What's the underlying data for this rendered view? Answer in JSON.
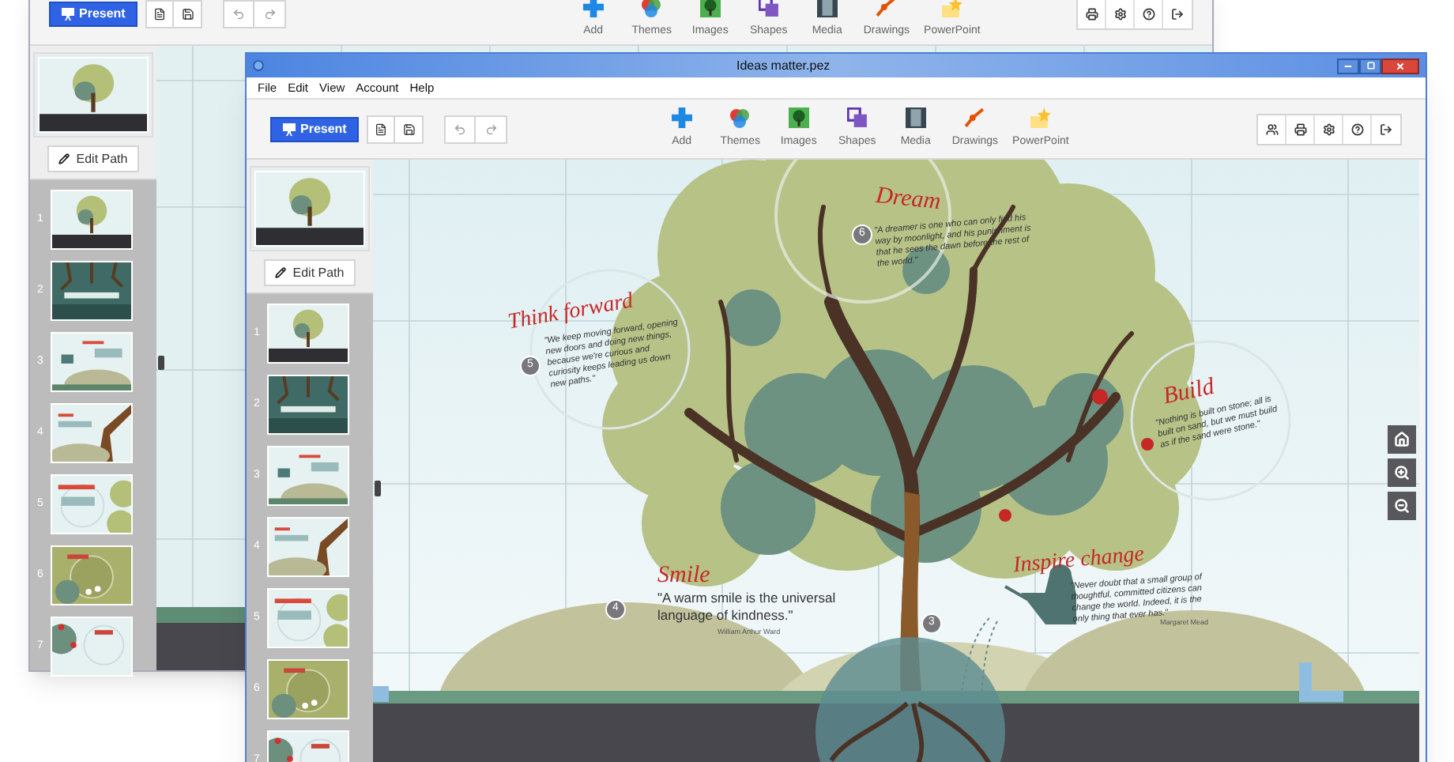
{
  "back_window": {
    "toolbar": {
      "present": "Present",
      "tools": [
        {
          "kind": "add",
          "label": "Add"
        },
        {
          "kind": "themes",
          "label": "Themes"
        },
        {
          "kind": "images",
          "label": "Images"
        },
        {
          "kind": "shapes",
          "label": "Shapes"
        },
        {
          "kind": "media",
          "label": "Media"
        },
        {
          "kind": "drawings",
          "label": "Drawings"
        },
        {
          "kind": "powerpoint",
          "label": "PowerPoint"
        }
      ]
    },
    "edit_path": "Edit Path",
    "slides": [
      {
        "number": "1"
      },
      {
        "number": "2"
      },
      {
        "number": "3"
      },
      {
        "number": "4"
      },
      {
        "number": "5"
      },
      {
        "number": "6"
      },
      {
        "number": "7"
      }
    ]
  },
  "front_window": {
    "title": "Ideas matter.pez",
    "menu": [
      "File",
      "Edit",
      "View",
      "Account",
      "Help"
    ],
    "toolbar": {
      "present": "Present",
      "tools": [
        {
          "kind": "add",
          "label": "Add"
        },
        {
          "kind": "themes",
          "label": "Themes"
        },
        {
          "kind": "images",
          "label": "Images"
        },
        {
          "kind": "shapes",
          "label": "Shapes"
        },
        {
          "kind": "media",
          "label": "Media"
        },
        {
          "kind": "drawings",
          "label": "Drawings"
        },
        {
          "kind": "powerpoint",
          "label": "PowerPoint"
        }
      ]
    },
    "edit_path": "Edit Path",
    "slides": [
      {
        "number": "1"
      },
      {
        "number": "2"
      },
      {
        "number": "3"
      },
      {
        "number": "4"
      },
      {
        "number": "5"
      },
      {
        "number": "6"
      },
      {
        "number": "7"
      }
    ],
    "canvas": {
      "topics": [
        {
          "number": "6",
          "title": "Dream",
          "quote": "\"A dreamer is one who can only find his way by moonlight, and his punishment is that he sees the dawn before the rest of the world.\""
        },
        {
          "number": "5",
          "title": "Think forward",
          "quote": "\"We keep moving forward, opening new doors and doing new things, because we're curious and curiosity keeps leading us down new paths.\""
        },
        {
          "title": "Build",
          "quote": "\"Nothing is built on stone; all is built on sand, but we must build as if the sand were stone.\""
        },
        {
          "number": "4",
          "title": "Smile",
          "quote": "\"A warm smile is the universal language of kindness.\"",
          "author": "William Arthur Ward"
        },
        {
          "number": "3",
          "title": "Inspire change",
          "quote": "\"Never doubt that a small group of thoughtful, committed citizens can change the world. Indeed, it is the only thing that ever has.\"",
          "author": "Margaret Mead"
        }
      ]
    }
  }
}
